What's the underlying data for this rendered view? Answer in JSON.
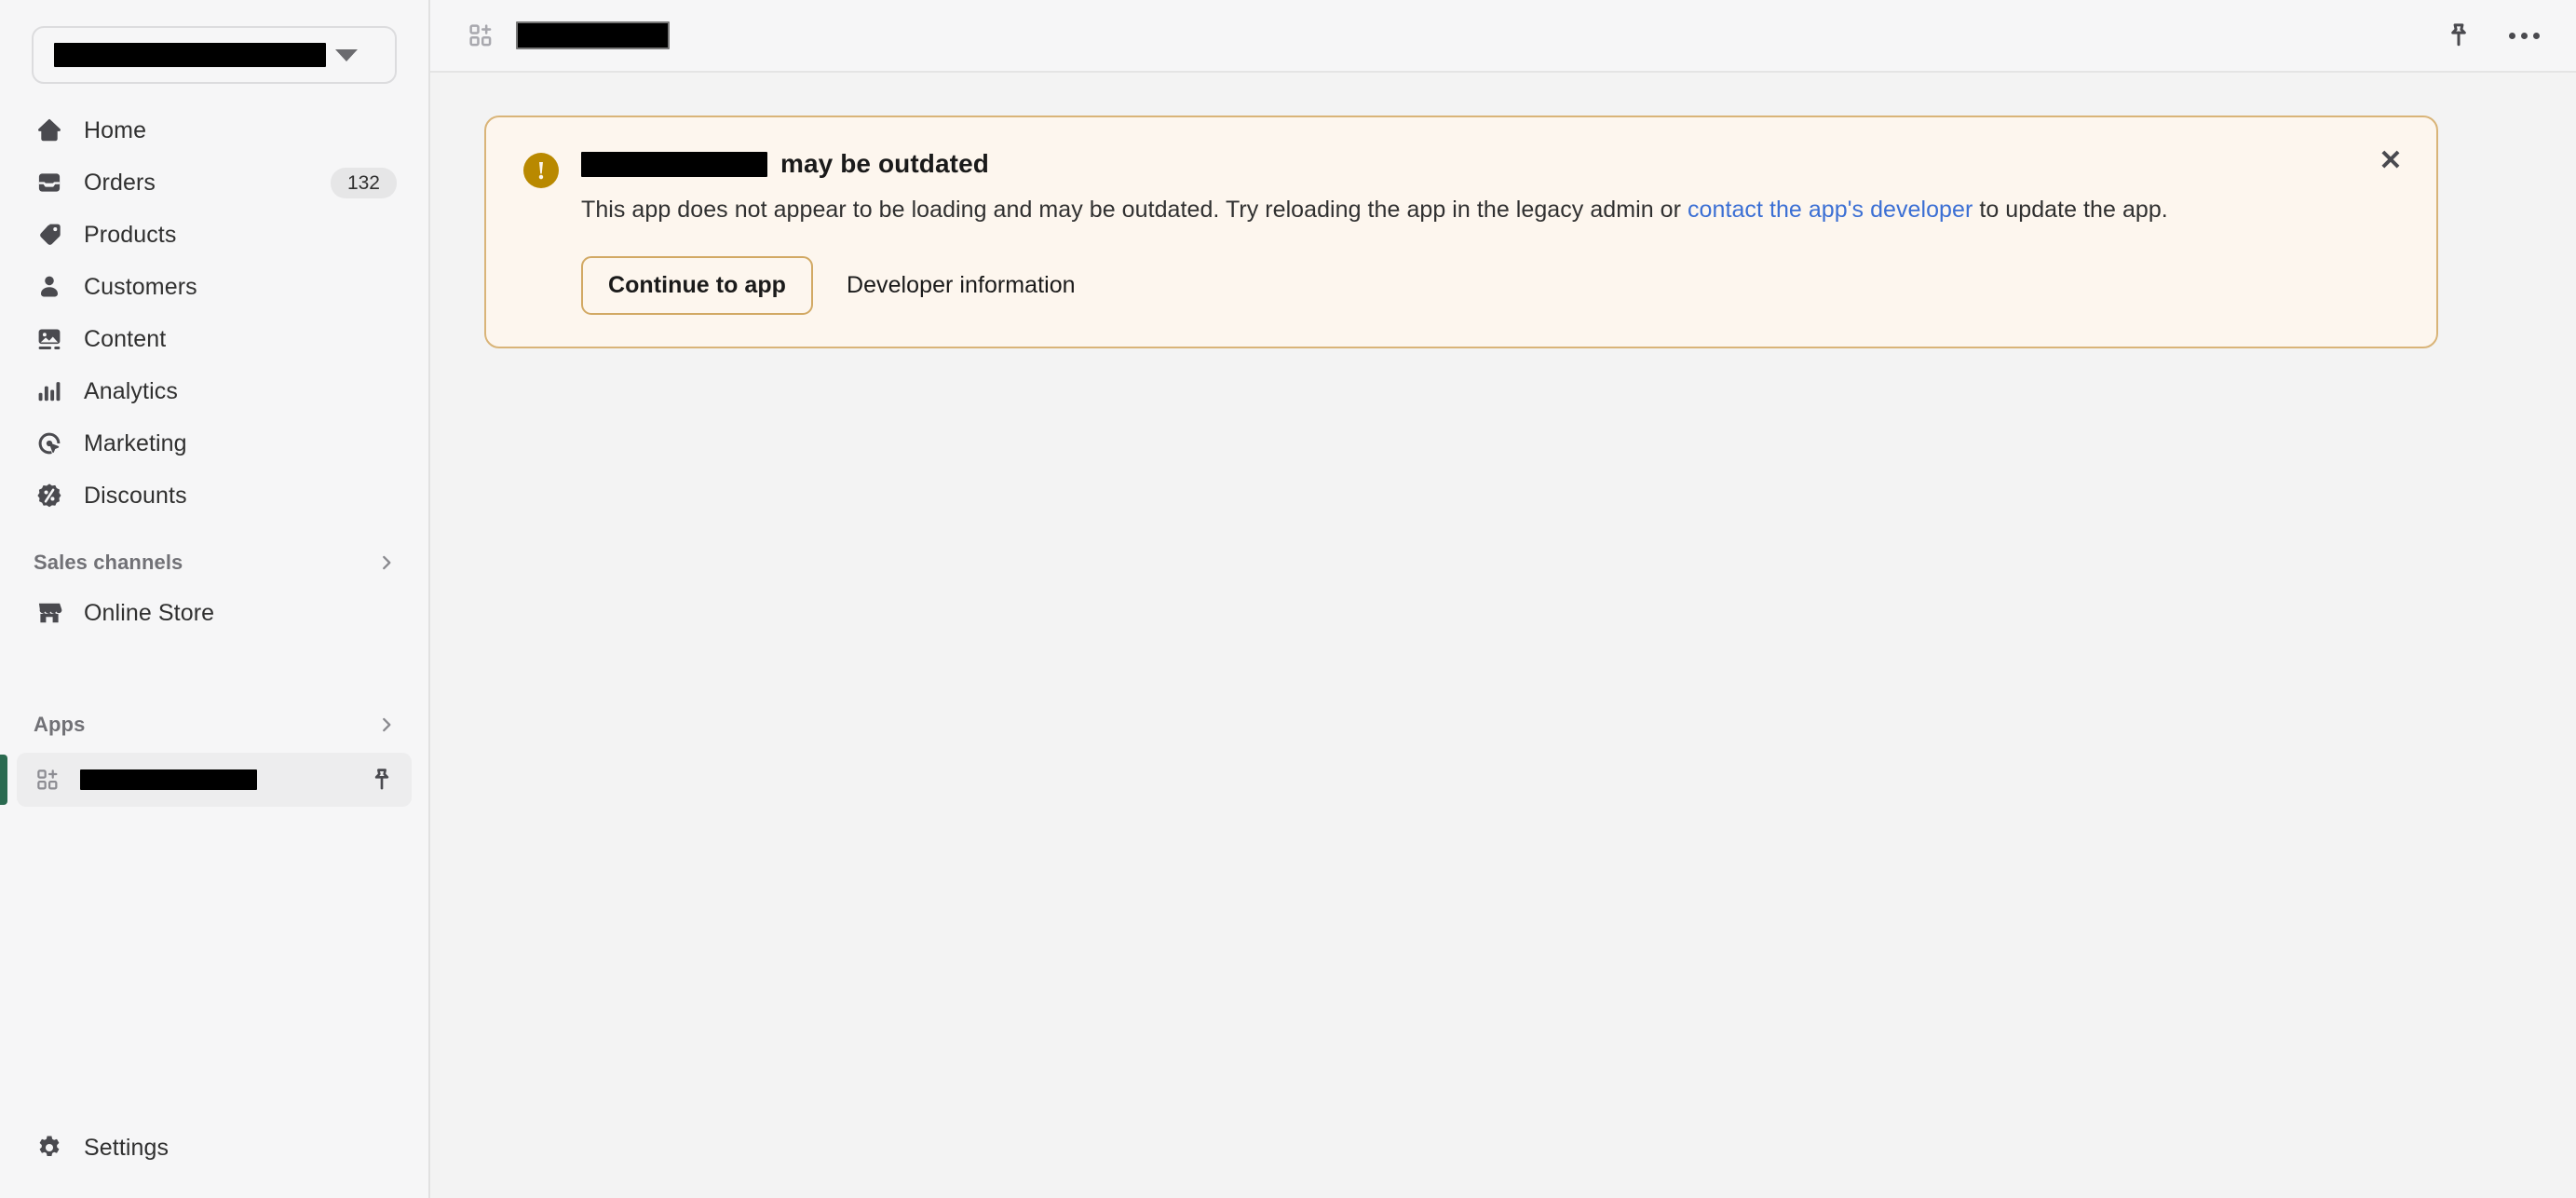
{
  "sidebar": {
    "store_selector": {
      "name_redacted": true,
      "caret_icon": "chevron-down-icon"
    },
    "items": [
      {
        "label": "Home",
        "icon": "home-icon",
        "badge": null
      },
      {
        "label": "Orders",
        "icon": "orders-inbox-icon",
        "badge": "132"
      },
      {
        "label": "Products",
        "icon": "product-tag-icon",
        "badge": null
      },
      {
        "label": "Customers",
        "icon": "person-icon",
        "badge": null
      },
      {
        "label": "Content",
        "icon": "content-image-icon",
        "badge": null
      },
      {
        "label": "Analytics",
        "icon": "bar-chart-icon",
        "badge": null
      },
      {
        "label": "Marketing",
        "icon": "marketing-target-icon",
        "badge": null
      },
      {
        "label": "Discounts",
        "icon": "discount-percent-icon",
        "badge": null
      }
    ],
    "groups": [
      {
        "title": "Sales channels",
        "chevron": "chevron-right-icon"
      },
      {
        "title": "Apps",
        "chevron": "chevron-right-icon"
      }
    ],
    "sales_channels": [
      {
        "label": "Online Store",
        "icon": "storefront-icon"
      }
    ],
    "pinned_app": {
      "name_redacted": true,
      "icon": "apps-grid-plus-icon",
      "pin_icon": "pin-icon",
      "selected": true,
      "accent_color": "#2A6A50"
    },
    "settings": {
      "label": "Settings",
      "icon": "gear-icon"
    }
  },
  "topbar": {
    "app_icon": "apps-grid-plus-icon",
    "title_redacted": true,
    "actions": [
      {
        "name": "pin",
        "icon": "pin-icon"
      },
      {
        "name": "more",
        "icon": "ellipsis-horizontal-icon"
      }
    ]
  },
  "banner": {
    "tone": "warning",
    "icon": "warning-exclamation-icon",
    "icon_glyph": "!",
    "app_name_redacted": true,
    "title_suffix": "may be outdated",
    "text_before_link": "This app does not appear to be loading and may be outdated. Try reloading the app in the legacy admin or ",
    "link_text": "contact the app's developer",
    "text_after_link": " to update the app.",
    "primary_action": "Continue to app",
    "secondary_action": "Developer information",
    "close_glyph": "✕",
    "colors": {
      "background": "#FDF6EE",
      "border": "#D9B478",
      "icon_fill": "#B98900",
      "link": "#3B6FD4"
    }
  }
}
